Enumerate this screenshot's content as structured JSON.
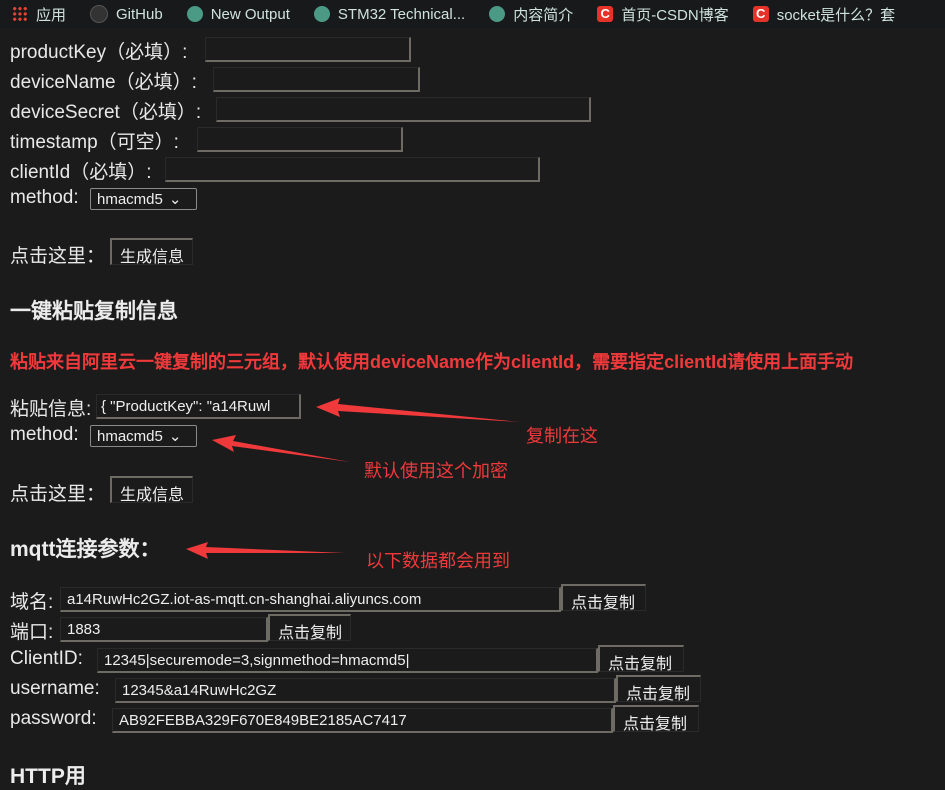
{
  "bookmarks": [
    {
      "label": "应用",
      "icon": "apps-grid-icon"
    },
    {
      "label": "GitHub",
      "icon": "github-icon"
    },
    {
      "label": "New Output",
      "icon": "globe-icon"
    },
    {
      "label": "STM32 Technical...",
      "icon": "globe-icon"
    },
    {
      "label": "内容简介",
      "icon": "globe-icon"
    },
    {
      "label": "首页-CSDN博客",
      "icon": "csdn-icon"
    },
    {
      "label": "socket是什么？套",
      "icon": "csdn-icon"
    }
  ],
  "form": {
    "productKey": "productKey（必填）:",
    "deviceName": "deviceName（必填）:",
    "deviceSecret": "deviceSecret（必填）:",
    "timestamp": "timestamp（可空）:",
    "clientId": "clientId（必填）:",
    "method_label": "method:",
    "method_value": "hmacmd5",
    "click_label": "点击这里：",
    "generate_button": "生成信息"
  },
  "paste_section": {
    "heading": "一键粘贴复制信息",
    "notice": "粘贴来自阿里云一键复制的三元组，默认使用deviceName作为clientId，需要指定clientId请使用上面手动",
    "paste_label": "粘贴信息:",
    "paste_value": "{   \"ProductKey\": \"a14Ruwl",
    "method_label": "method:",
    "method_value": "hmacmd5",
    "click_label": "点击这里：",
    "generate_button": "生成信息"
  },
  "annotations": {
    "copy_here": "复制在这",
    "default_encrypt": "默认使用这个加密",
    "all_used": "以下数据都会用到",
    "color": "#f0393a"
  },
  "mqtt": {
    "heading": "mqtt连接参数：",
    "copy_button": "点击复制",
    "fields": [
      {
        "label": "域名:",
        "value": "a14RuwHc2GZ.iot-as-mqtt.cn-shanghai.aliyuncs.com"
      },
      {
        "label": "端口:",
        "value": "1883"
      },
      {
        "label": "ClientID:",
        "value": "12345|securemode=3,signmethod=hmacmd5|"
      },
      {
        "label": "username:",
        "value": "12345&a14RuwHc2GZ"
      },
      {
        "label": "password:",
        "value": "AB92FEBBA329F670E849BE2185AC7417"
      }
    ]
  },
  "http_heading": "HTTP用"
}
